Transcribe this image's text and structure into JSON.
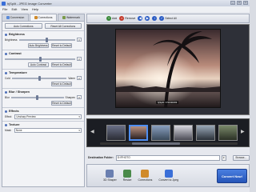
{
  "window": {
    "title": "hjSplit - JPEG Image Converter"
  },
  "menu": [
    "File",
    "Edit",
    "View",
    "Help"
  ],
  "left_tabs": [
    {
      "label": "Conversion",
      "icon": "conversion-icon"
    },
    {
      "label": "Corrections",
      "icon": "corrections-icon"
    },
    {
      "label": "Watermark",
      "icon": "watermark-icon"
    }
  ],
  "auto": {
    "auto_corrections": "Auto Corrections",
    "reset_all": "Reset All Corrections"
  },
  "brightness": {
    "title": "Brightness",
    "label": "Brightness",
    "value": "0",
    "level": 0.5,
    "auto_btn": "Auto Brightness",
    "reset_btn": "Reset to Default"
  },
  "contrast": {
    "title": "Contrast",
    "value": "0",
    "level": 0.5,
    "auto_btn": "Auto Contrast",
    "reset_btn": "Reset to Default"
  },
  "temperature": {
    "title": "Temperature",
    "cold": "Cold",
    "warm": "Warm",
    "value": "0",
    "level": 0.5,
    "reset_btn": "Reset to Default"
  },
  "blur": {
    "title": "Blur / Sharpen",
    "blur": "Blur",
    "sharpen": "Sharpen",
    "value": "0",
    "level": 0.5,
    "reset_btn": "Reset to Default"
  },
  "effects": {
    "title": "Effects",
    "label": "Effect",
    "selected": "Unsharp Preview"
  },
  "texture": {
    "title": "Texture",
    "label": "Mask",
    "selected": "None"
  },
  "toolbar": {
    "add": "Add",
    "remove": "Remove",
    "select_all": "Select All"
  },
  "preview": {
    "caption": "hjSplit / P1040203"
  },
  "destination": {
    "label": "Destination Folder:",
    "value": "D:\\PHOTO",
    "browse": "Browse..."
  },
  "bottom_buttons": [
    {
      "label": "3D Shaper",
      "icon": "3d-shaper-icon",
      "color": "#6a7fb0"
    },
    {
      "label": "Resize",
      "icon": "resize-icon",
      "color": "#4a8a4a"
    },
    {
      "label": "Corrections",
      "icon": "corrections-icon",
      "color": "#d08a2a"
    },
    {
      "label": "Convert to Jpeg",
      "icon": "convert-jpeg-icon",
      "color": "#3a6fd8"
    }
  ],
  "convert": {
    "label": "Convert Now!"
  },
  "colors": {
    "accent": "#2b5cc4",
    "panel": "#f2f3f6",
    "film": "#1b1d23"
  }
}
